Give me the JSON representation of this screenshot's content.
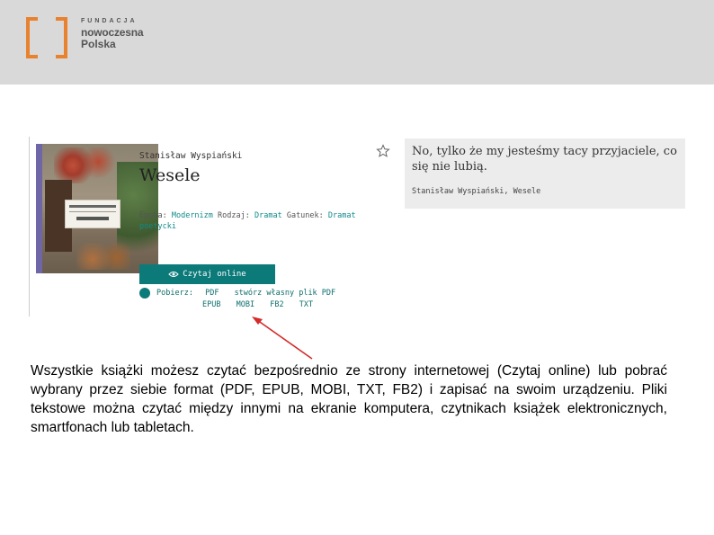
{
  "header": {
    "logo": {
      "line1": "FUNDACJA",
      "line2": "nowoczesna",
      "line3": "Polska"
    }
  },
  "book": {
    "author": "Stanisław Wyspiański",
    "title": "Wesele",
    "meta": {
      "epoch_label": "Epoka:",
      "epoch": "Modernizm",
      "kind_label": "Rodzaj:",
      "kind": "Dramat",
      "genre_label": "Gatunek:",
      "genre": "Dramat poetycki"
    },
    "read_button": "Czytaj online",
    "download": {
      "label": "Pobierz:",
      "formats_row1": [
        "PDF",
        "stwórz własny plik PDF"
      ],
      "formats_row2": [
        "EPUB",
        "MOBI",
        "FB2",
        "TXT"
      ]
    }
  },
  "quote": {
    "text": "No, tylko że my jesteśmy tacy przyjaciele, co się nie lubią.",
    "source": "Stanisław Wyspiański, Wesele"
  },
  "description": "Wszystkie książki możesz czytać bezpośrednio ze strony internetowej (Czytaj online) lub pobrać wybrany przez siebie format (PDF, EPUB, MOBI, TXT, FB2) i zapisać na swoim urządzeniu. Pliki tekstowe można czytać między innymi na ekranie komputera, czytnikach książek elektronicznych, smartfonach lub tabletach.",
  "colors": {
    "header_band": "#d9d9d9",
    "logo_orange": "#e8822f",
    "teal": "#0d7a7a",
    "arrow_red": "#d42b2b",
    "quote_bg": "#ececec"
  },
  "icons": [
    "logo-bracket-icon",
    "star-icon",
    "eye-icon",
    "download-icon"
  ]
}
